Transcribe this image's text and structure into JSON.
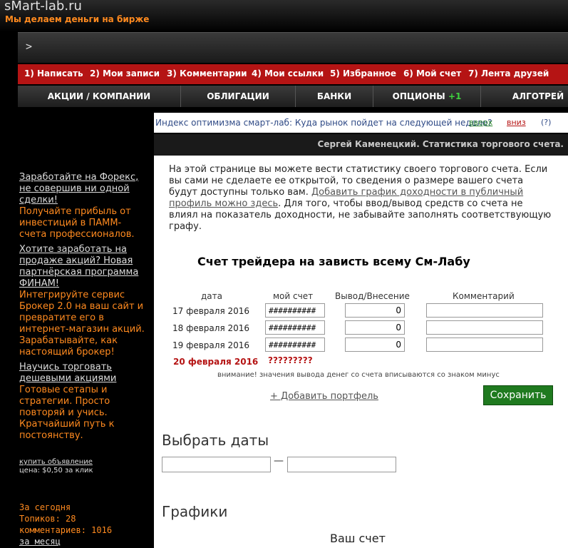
{
  "header": {
    "logo": "sMart-lab.ru",
    "slogan": "Мы делаем деньги на бирже",
    "prompt": ">"
  },
  "usernav": [
    "1) Написать",
    "2) Мои записи",
    "3) Комментарии",
    "4) Мои ссылки",
    "5) Избранное",
    "6) Мой счет",
    "7) Лента друзей"
  ],
  "catnav": {
    "items": [
      "АКЦИИ / КОМПАНИИ",
      "ОБЛИГАЦИИ",
      "БАНКИ",
      "ОПЦИОНЫ",
      "АЛГОТРЕЙ"
    ],
    "options_badge": "+1"
  },
  "ticker": {
    "text": "Индекс оптимизма смарт-лаб: Куда рынок пойдет на следующей неделе?",
    "up": "вверх",
    "down": "вниз",
    "help": "(?)"
  },
  "author_bar": "Сергей Каменецкий. Статистика торгового счета.",
  "sidebar": {
    "ad1_link": "Заработайте на Форекс, не совершив ни одной сделки!",
    "ad1_text": "Получайте прибыль от инвестиций в ПАММ-счета профессионалов.",
    "ad2_link": "Хотите заработать на продаже акций? Новая партнёрская программа ФИНАМ!",
    "ad2_text": "Интегрируйте сервис Брокер 2.0 на ваш сайт и превратите его в интернет-магазин акций. Зарабатывайте, как настоящий брокер!",
    "ad3_link": "Научись торговать дешевыми акциями",
    "ad3_text": "Готовые сетапы и стратегии. Просто повторяй и учись. Кратчайший путь к постоянству.",
    "buy_ad": "купить объявление",
    "price": "цена: $0,50 за клик",
    "stats_today": "За сегодня",
    "stats_topics": "Топиков: 28",
    "stats_comments": "комментариев: 1016",
    "stats_month": "за месяц"
  },
  "intro": {
    "text1": "На этой странице вы можете вести статистику своего торгового счета. Если вы сами не сделаете ее открытой, то сведения о размере вашего счета будут доступны только вам. ",
    "link": "Добавить график доходности в публичный профиль можно здесь",
    "text2": ". Для того, чтобы ввод/вывод средств со счета не влиял на показатель доходности, не забывайте заполнять соответствующую графу."
  },
  "account_title": "Счет трейдера  на зависть всему См-Лабу",
  "table": {
    "headers": [
      "дата",
      "мой счет",
      "Вывод/Внесение",
      "Комментарий"
    ],
    "rows": [
      {
        "date": "17 февраля 2016",
        "account": "##########",
        "flow": "0",
        "comment": ""
      },
      {
        "date": "18 февраля 2016",
        "account": "##########",
        "flow": "0",
        "comment": ""
      },
      {
        "date": "19 февраля 2016",
        "account": "##########",
        "flow": "0",
        "comment": ""
      }
    ],
    "today_date": "20 февраля 2016",
    "today_value": "?????????"
  },
  "note": "внимание! значения вывода денег со счета вписываются со знаком минус",
  "add_portfolio": "+ Добавить портфель",
  "save_label": "Сохранить",
  "dates_title": "Выбрать даты",
  "date_separator": "—",
  "charts_title": "Графики",
  "chart_subtitle": "Ваш счет"
}
